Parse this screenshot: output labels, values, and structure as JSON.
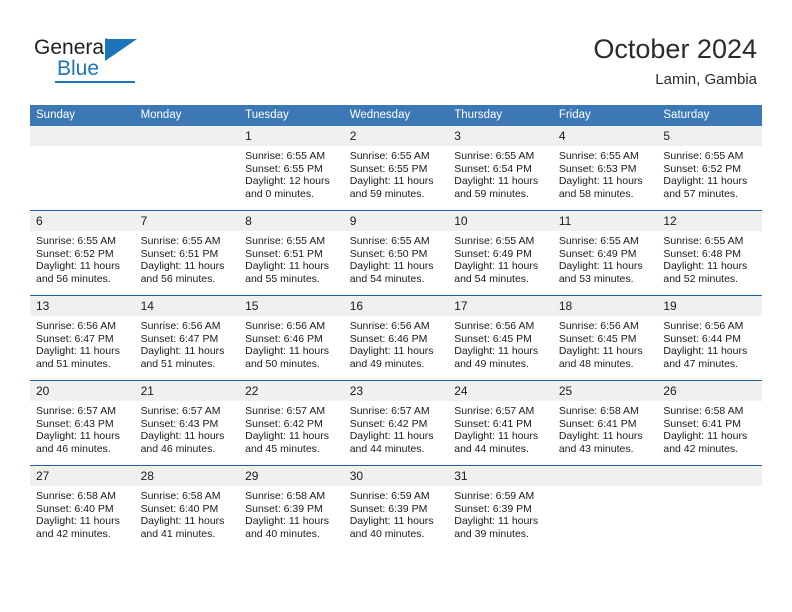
{
  "brand": {
    "name_top": "General",
    "name_bottom": "Blue",
    "accent_color": "#1b75bb",
    "logo_icon": "triangle-flag-icon"
  },
  "header": {
    "month_title": "October 2024",
    "location": "Lamin, Gambia"
  },
  "theme": {
    "header_blue": "#3b78b5",
    "row_divider_blue": "#1f62ab",
    "day_number_band": "#f0f0f0"
  },
  "weekdays": [
    "Sunday",
    "Monday",
    "Tuesday",
    "Wednesday",
    "Thursday",
    "Friday",
    "Saturday"
  ],
  "weeks": [
    [
      {
        "day": "",
        "lines": []
      },
      {
        "day": "",
        "lines": []
      },
      {
        "day": "1",
        "lines": [
          "Sunrise: 6:55 AM",
          "Sunset: 6:55 PM",
          "Daylight: 12 hours",
          "and 0 minutes."
        ]
      },
      {
        "day": "2",
        "lines": [
          "Sunrise: 6:55 AM",
          "Sunset: 6:55 PM",
          "Daylight: 11 hours",
          "and 59 minutes."
        ]
      },
      {
        "day": "3",
        "lines": [
          "Sunrise: 6:55 AM",
          "Sunset: 6:54 PM",
          "Daylight: 11 hours",
          "and 59 minutes."
        ]
      },
      {
        "day": "4",
        "lines": [
          "Sunrise: 6:55 AM",
          "Sunset: 6:53 PM",
          "Daylight: 11 hours",
          "and 58 minutes."
        ]
      },
      {
        "day": "5",
        "lines": [
          "Sunrise: 6:55 AM",
          "Sunset: 6:52 PM",
          "Daylight: 11 hours",
          "and 57 minutes."
        ]
      }
    ],
    [
      {
        "day": "6",
        "lines": [
          "Sunrise: 6:55 AM",
          "Sunset: 6:52 PM",
          "Daylight: 11 hours",
          "and 56 minutes."
        ]
      },
      {
        "day": "7",
        "lines": [
          "Sunrise: 6:55 AM",
          "Sunset: 6:51 PM",
          "Daylight: 11 hours",
          "and 56 minutes."
        ]
      },
      {
        "day": "8",
        "lines": [
          "Sunrise: 6:55 AM",
          "Sunset: 6:51 PM",
          "Daylight: 11 hours",
          "and 55 minutes."
        ]
      },
      {
        "day": "9",
        "lines": [
          "Sunrise: 6:55 AM",
          "Sunset: 6:50 PM",
          "Daylight: 11 hours",
          "and 54 minutes."
        ]
      },
      {
        "day": "10",
        "lines": [
          "Sunrise: 6:55 AM",
          "Sunset: 6:49 PM",
          "Daylight: 11 hours",
          "and 54 minutes."
        ]
      },
      {
        "day": "11",
        "lines": [
          "Sunrise: 6:55 AM",
          "Sunset: 6:49 PM",
          "Daylight: 11 hours",
          "and 53 minutes."
        ]
      },
      {
        "day": "12",
        "lines": [
          "Sunrise: 6:55 AM",
          "Sunset: 6:48 PM",
          "Daylight: 11 hours",
          "and 52 minutes."
        ]
      }
    ],
    [
      {
        "day": "13",
        "lines": [
          "Sunrise: 6:56 AM",
          "Sunset: 6:47 PM",
          "Daylight: 11 hours",
          "and 51 minutes."
        ]
      },
      {
        "day": "14",
        "lines": [
          "Sunrise: 6:56 AM",
          "Sunset: 6:47 PM",
          "Daylight: 11 hours",
          "and 51 minutes."
        ]
      },
      {
        "day": "15",
        "lines": [
          "Sunrise: 6:56 AM",
          "Sunset: 6:46 PM",
          "Daylight: 11 hours",
          "and 50 minutes."
        ]
      },
      {
        "day": "16",
        "lines": [
          "Sunrise: 6:56 AM",
          "Sunset: 6:46 PM",
          "Daylight: 11 hours",
          "and 49 minutes."
        ]
      },
      {
        "day": "17",
        "lines": [
          "Sunrise: 6:56 AM",
          "Sunset: 6:45 PM",
          "Daylight: 11 hours",
          "and 49 minutes."
        ]
      },
      {
        "day": "18",
        "lines": [
          "Sunrise: 6:56 AM",
          "Sunset: 6:45 PM",
          "Daylight: 11 hours",
          "and 48 minutes."
        ]
      },
      {
        "day": "19",
        "lines": [
          "Sunrise: 6:56 AM",
          "Sunset: 6:44 PM",
          "Daylight: 11 hours",
          "and 47 minutes."
        ]
      }
    ],
    [
      {
        "day": "20",
        "lines": [
          "Sunrise: 6:57 AM",
          "Sunset: 6:43 PM",
          "Daylight: 11 hours",
          "and 46 minutes."
        ]
      },
      {
        "day": "21",
        "lines": [
          "Sunrise: 6:57 AM",
          "Sunset: 6:43 PM",
          "Daylight: 11 hours",
          "and 46 minutes."
        ]
      },
      {
        "day": "22",
        "lines": [
          "Sunrise: 6:57 AM",
          "Sunset: 6:42 PM",
          "Daylight: 11 hours",
          "and 45 minutes."
        ]
      },
      {
        "day": "23",
        "lines": [
          "Sunrise: 6:57 AM",
          "Sunset: 6:42 PM",
          "Daylight: 11 hours",
          "and 44 minutes."
        ]
      },
      {
        "day": "24",
        "lines": [
          "Sunrise: 6:57 AM",
          "Sunset: 6:41 PM",
          "Daylight: 11 hours",
          "and 44 minutes."
        ]
      },
      {
        "day": "25",
        "lines": [
          "Sunrise: 6:58 AM",
          "Sunset: 6:41 PM",
          "Daylight: 11 hours",
          "and 43 minutes."
        ]
      },
      {
        "day": "26",
        "lines": [
          "Sunrise: 6:58 AM",
          "Sunset: 6:41 PM",
          "Daylight: 11 hours",
          "and 42 minutes."
        ]
      }
    ],
    [
      {
        "day": "27",
        "lines": [
          "Sunrise: 6:58 AM",
          "Sunset: 6:40 PM",
          "Daylight: 11 hours",
          "and 42 minutes."
        ]
      },
      {
        "day": "28",
        "lines": [
          "Sunrise: 6:58 AM",
          "Sunset: 6:40 PM",
          "Daylight: 11 hours",
          "and 41 minutes."
        ]
      },
      {
        "day": "29",
        "lines": [
          "Sunrise: 6:58 AM",
          "Sunset: 6:39 PM",
          "Daylight: 11 hours",
          "and 40 minutes."
        ]
      },
      {
        "day": "30",
        "lines": [
          "Sunrise: 6:59 AM",
          "Sunset: 6:39 PM",
          "Daylight: 11 hours",
          "and 40 minutes."
        ]
      },
      {
        "day": "31",
        "lines": [
          "Sunrise: 6:59 AM",
          "Sunset: 6:39 PM",
          "Daylight: 11 hours",
          "and 39 minutes."
        ]
      },
      {
        "day": "",
        "lines": []
      },
      {
        "day": "",
        "lines": []
      }
    ]
  ]
}
